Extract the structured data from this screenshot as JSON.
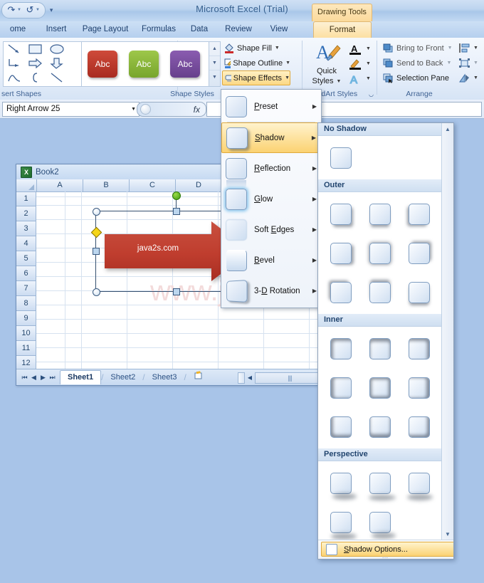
{
  "titlebar": {
    "app_title": "Microsoft Excel (Trial)",
    "contextual_tab": "Drawing Tools",
    "qat": {
      "undo": "undo-icon",
      "redo": "redo-icon",
      "customize": "customize-quick-access-toolbar"
    }
  },
  "tabs": [
    {
      "label": "ome",
      "active": false
    },
    {
      "label": "Insert",
      "active": false
    },
    {
      "label": "Page Layout",
      "active": false
    },
    {
      "label": "Formulas",
      "active": false
    },
    {
      "label": "Data",
      "active": false
    },
    {
      "label": "Review",
      "active": false
    },
    {
      "label": "View",
      "active": false
    },
    {
      "label": "Format",
      "active": true
    }
  ],
  "ribbon": {
    "groups": [
      {
        "label": "sert Shapes"
      },
      {
        "label": "Shape Styles"
      },
      {
        "label": "rdArt Styles"
      },
      {
        "label": "Arrange"
      }
    ],
    "shape_styles": [
      {
        "text": "Abc",
        "color": "#c0392b"
      },
      {
        "text": "Abc",
        "color": "#8cb83c"
      },
      {
        "text": "Abc",
        "color": "#7a4fa3"
      }
    ],
    "shape_effect_buttons": [
      {
        "label": "Shape Fill",
        "icon": "paint-bucket-icon",
        "active": false
      },
      {
        "label": "Shape Outline",
        "icon": "pencil-outline-icon",
        "active": false
      },
      {
        "label": "Shape Effects",
        "icon": "shape-effects-icon",
        "active": true
      }
    ],
    "wordart": {
      "quick_styles_line1": "Quick",
      "quick_styles_line2": "Styles",
      "text_fill": "A",
      "text_outline": "A",
      "text_effects": "A"
    },
    "arrange": {
      "bring_to_front": "Bring to Front",
      "send_to_back": "Send to Back",
      "selection_pane": "Selection Pane",
      "align": "align-icon",
      "group": "group-icon",
      "rotate": "rotate-icon"
    }
  },
  "formula_bar": {
    "name_box_value": "Right Arrow 25",
    "fx_label": "fx",
    "formula_value": ""
  },
  "workbook": {
    "title": "Book2",
    "columns": [
      "A",
      "B",
      "C",
      "D"
    ],
    "rows": [
      "1",
      "2",
      "3",
      "4",
      "5",
      "6",
      "7",
      "8",
      "9",
      "10",
      "11",
      "12"
    ],
    "shape": {
      "name": "Right Arrow 25",
      "text": "java2s.com",
      "fill_color": "#c0392b"
    },
    "watermark": "www.java2s.com",
    "sheet_tabs": [
      {
        "label": "Sheet1",
        "active": true
      },
      {
        "label": "Sheet2",
        "active": false
      },
      {
        "label": "Sheet3",
        "active": false
      }
    ],
    "insert_sheet_icon": "insert-worksheet-icon"
  },
  "shape_effects_menu": {
    "items": [
      {
        "label": "Preset",
        "accel": "P",
        "chip": "preset",
        "selected": false
      },
      {
        "label": "Shadow",
        "accel": "S",
        "chip": "shadow",
        "selected": true
      },
      {
        "label": "Reflection",
        "accel": "R",
        "chip": "reflection",
        "selected": false
      },
      {
        "label": "Glow",
        "accel": "G",
        "chip": "glow",
        "selected": false
      },
      {
        "label": "Soft Edges",
        "accel": "E",
        "chip": "soft",
        "selected": false
      },
      {
        "label": "Bevel",
        "accel": "B",
        "chip": "bevel",
        "selected": false
      },
      {
        "label": "3-D Rotation",
        "accel": "D",
        "chip": "rotation",
        "selected": false
      }
    ]
  },
  "shadow_gallery": {
    "sections": [
      {
        "title": "No Shadow",
        "items": [
          {
            "name": "No Shadow",
            "style": "none"
          }
        ]
      },
      {
        "title": "Outer",
        "items": [
          {
            "name": "Offset Diagonal Bottom Right",
            "style": "d2"
          },
          {
            "name": "Offset Bottom",
            "style": "d1"
          },
          {
            "name": "Offset Diagonal Bottom Left",
            "style": "d3"
          },
          {
            "name": "Offset Diagonal Top Right",
            "style": "d5"
          },
          {
            "name": "Offset Right",
            "style": "d4"
          },
          {
            "name": "Offset Left",
            "style": "d8"
          },
          {
            "name": "Offset Diagonal Top Left",
            "style": "d6"
          },
          {
            "name": "Offset Top",
            "style": "d7"
          },
          {
            "name": "Offset Center",
            "style": "d0"
          }
        ]
      },
      {
        "title": "Inner",
        "items": [
          {
            "name": "Inside Diagonal Top Left",
            "style": "i0"
          },
          {
            "name": "Inside Top",
            "style": "i1"
          },
          {
            "name": "Inside Diagonal Top Right",
            "style": "i2"
          },
          {
            "name": "Inside Left",
            "style": "i3"
          },
          {
            "name": "Inside Center",
            "style": "i4"
          },
          {
            "name": "Inside Right",
            "style": "i5"
          },
          {
            "name": "Inside Diagonal Bottom Left",
            "style": "i6"
          },
          {
            "name": "Inside Bottom",
            "style": "i7"
          },
          {
            "name": "Inside Diagonal Bottom Right",
            "style": "i8"
          }
        ]
      },
      {
        "title": "Perspective",
        "items": [
          {
            "name": "Perspective Diagonal Upper Left",
            "style": "p1"
          },
          {
            "name": "Perspective Diagonal Upper Right",
            "style": "p2"
          },
          {
            "name": "Below",
            "style": "p3"
          },
          {
            "name": "Perspective Diagonal Lower Left",
            "style": "p4"
          },
          {
            "name": "Perspective Diagonal Lower Right",
            "style": "p1"
          }
        ]
      }
    ],
    "footer_label": "Shadow Options...",
    "footer_accel": "S"
  }
}
